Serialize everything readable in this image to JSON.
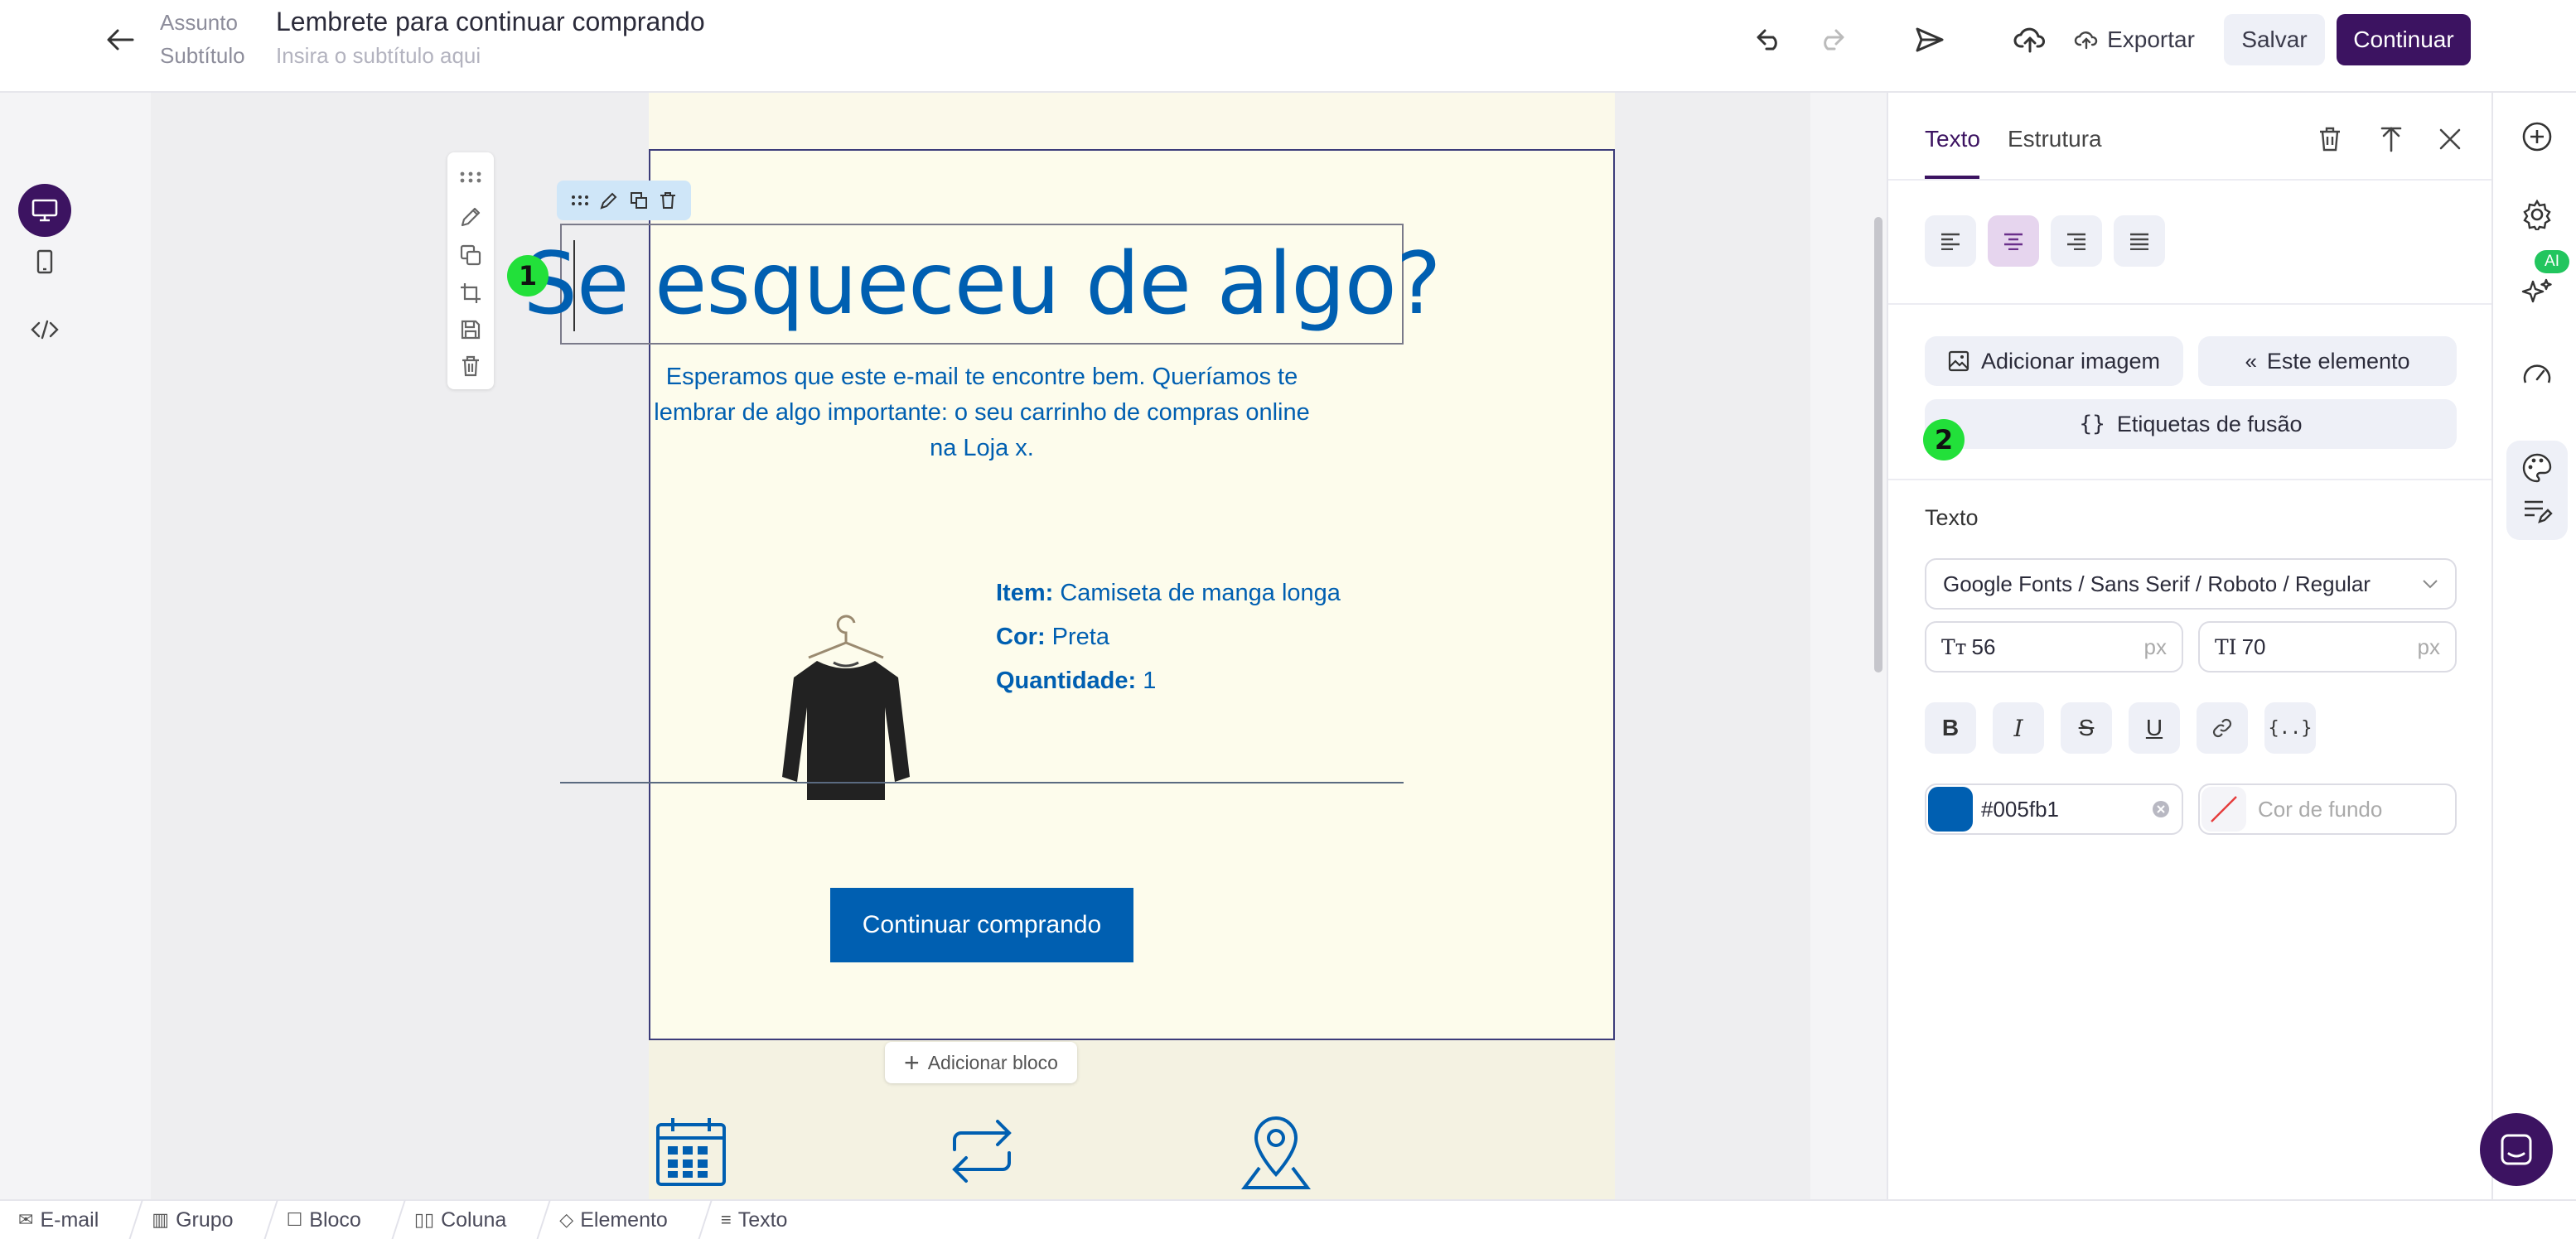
{
  "header": {
    "subject_label": "Assunto",
    "subject_value": "Lembrete para continuar comprando",
    "subtitle_label": "Subtítulo",
    "subtitle_placeholder": "Insira o subtítulo aqui",
    "export_label": "Exportar",
    "save_label": "Salvar",
    "continue_label": "Continuar"
  },
  "email": {
    "heading": "Se esqueceu de algo?",
    "intro_line1": "Esperamos que este e-mail te encontre bem. Queríamos te",
    "intro_line2": "lembrar de algo importante: o seu carrinho de compras online",
    "intro_line3": "na Loja x.",
    "item_label": "Item:",
    "item_value": "Camiseta de manga longa",
    "color_label": "Cor:",
    "color_value": "Preta",
    "qty_label": "Quantidade:",
    "qty_value": "1",
    "cta": "Continuar comprando",
    "add_block": "Adicionar bloco"
  },
  "panel": {
    "tab_text": "Texto",
    "tab_structure": "Estrutura",
    "add_image": "Adicionar imagem",
    "this_element": "Este elemento",
    "merge_tags": "Etiquetas de fusão",
    "section_text": "Texto",
    "font": "Google Fonts / Sans Serif / Roboto / Regular",
    "font_size": "56",
    "line_height": "70",
    "unit": "px",
    "text_color": "#005fb1",
    "bg_color_placeholder": "Cor de fundo"
  },
  "rail": {
    "ai_badge": "AI"
  },
  "markers": {
    "one": "1",
    "two": "2"
  },
  "breadcrumb": [
    "E-mail",
    "Grupo",
    "Bloco",
    "Coluna",
    "Elemento",
    "Texto"
  ],
  "colors": {
    "brand_dark": "#3c1361",
    "text_blue": "#005fb1",
    "email_bg": "#fbf9ea"
  }
}
